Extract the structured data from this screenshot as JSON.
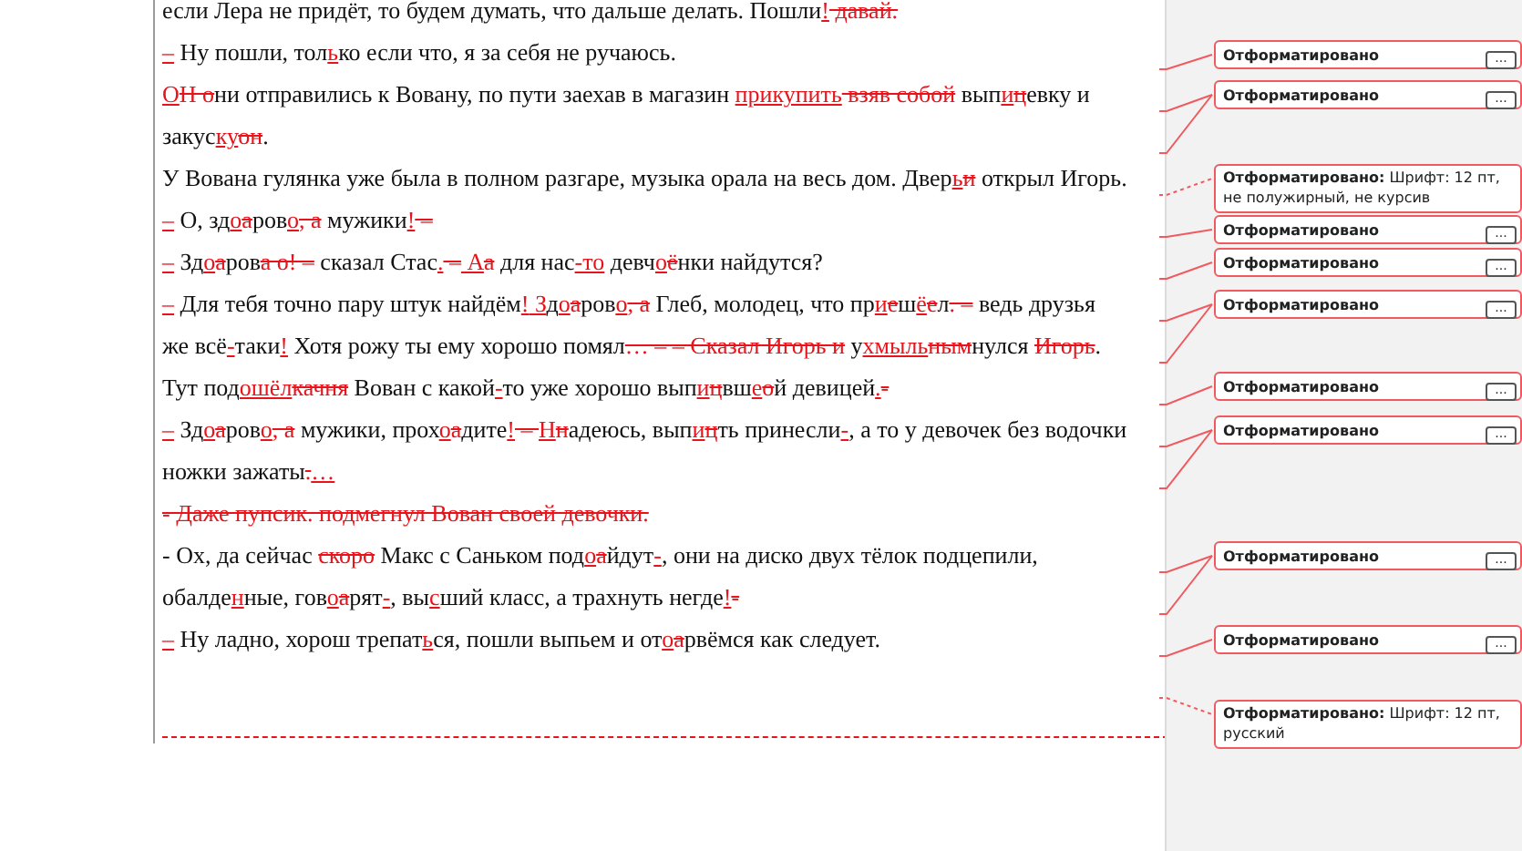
{
  "document": {
    "lines": [
      [
        {
          "kind": "plain",
          "text": "если Лера не придёт, то будем думать, что дальше делать. Пошли"
        },
        {
          "kind": "ins",
          "text": "!"
        },
        {
          "kind": "del",
          "text": " давай."
        }
      ],
      [
        {
          "kind": "ins",
          "text": "–"
        },
        {
          "kind": "plain",
          "text": " Ну пошли, тол"
        },
        {
          "kind": "ins",
          "text": "ь"
        },
        {
          "kind": "plain",
          "text": "ко если что, я за себя не ручаюсь."
        }
      ],
      [
        {
          "kind": "ins",
          "text": "О"
        },
        {
          "kind": "del",
          "text": "Н о"
        },
        {
          "kind": "plain",
          "text": "ни отправились к Вовану, по пути заехав в магазин "
        },
        {
          "kind": "ins",
          "text": "прикупить"
        },
        {
          "kind": "del",
          "text": " взяв собой"
        },
        {
          "kind": "plain",
          "text": " вып"
        },
        {
          "kind": "ins",
          "text": "и"
        },
        {
          "kind": "del",
          "text": "ц"
        },
        {
          "kind": "plain",
          "text": "евку и"
        }
      ],
      [
        {
          "kind": "plain",
          "text": "закус"
        },
        {
          "kind": "ins",
          "text": "ку"
        },
        {
          "kind": "del",
          "text": "он"
        },
        {
          "kind": "plain",
          "text": "."
        }
      ],
      [
        {
          "kind": "plain",
          "text": "У Вована гулянка уже была в полном разгаре, музыка орала на весь дом. Двер"
        },
        {
          "kind": "ins",
          "text": "ь"
        },
        {
          "kind": "del",
          "text": "и"
        },
        {
          "kind": "plain",
          "text": " открыл Игорь."
        }
      ],
      [
        {
          "kind": "ins",
          "text": "–"
        },
        {
          "kind": "plain",
          "text": " О, зд"
        },
        {
          "kind": "ins",
          "text": "о"
        },
        {
          "kind": "del",
          "text": "а"
        },
        {
          "kind": "plain",
          "text": "ров"
        },
        {
          "kind": "ins",
          "text": "о"
        },
        {
          "kind": "del",
          "text": ", а"
        },
        {
          "kind": "plain",
          "text": " мужики"
        },
        {
          "kind": "ins",
          "text": "!"
        },
        {
          "kind": "del",
          "text": " –"
        }
      ],
      [
        {
          "kind": "ins",
          "text": "–"
        },
        {
          "kind": "plain",
          "text": " Зд"
        },
        {
          "kind": "ins",
          "text": "о"
        },
        {
          "kind": "del",
          "text": "а"
        },
        {
          "kind": "plain",
          "text": "ров"
        },
        {
          "kind": "del",
          "text": "а о! –"
        },
        {
          "kind": "plain",
          "text": " сказал Стас"
        },
        {
          "kind": "ins",
          "text": "."
        },
        {
          "kind": "del",
          "text": " –"
        },
        {
          "kind": "ins",
          "text": " А"
        },
        {
          "kind": "del",
          "text": "а"
        },
        {
          "kind": "plain",
          "text": " для нас"
        },
        {
          "kind": "ins",
          "text": "-то"
        },
        {
          "kind": "plain",
          "text": " девч"
        },
        {
          "kind": "ins",
          "text": "о"
        },
        {
          "kind": "del",
          "text": "ё"
        },
        {
          "kind": "plain",
          "text": "нки найдутся?"
        }
      ],
      [
        {
          "kind": "ins",
          "text": "–"
        },
        {
          "kind": "plain",
          "text": " Для тебя точно пару штук найдём"
        },
        {
          "kind": "ins",
          "text": "!"
        },
        {
          "kind": "ins",
          "text": " З"
        },
        {
          "kind": "plain",
          "text": "д"
        },
        {
          "kind": "ins",
          "text": "о"
        },
        {
          "kind": "del",
          "text": "а"
        },
        {
          "kind": "plain",
          "text": "ров"
        },
        {
          "kind": "ins",
          "text": "о"
        },
        {
          "kind": "del",
          "text": ", а"
        },
        {
          "kind": "plain",
          "text": " Глеб, молодец, что пр"
        },
        {
          "kind": "ins",
          "text": "и"
        },
        {
          "kind": "del",
          "text": "е"
        },
        {
          "kind": "plain",
          "text": "ш"
        },
        {
          "kind": "ins",
          "text": "ё"
        },
        {
          "kind": "del",
          "text": "е"
        },
        {
          "kind": "plain",
          "text": "л"
        },
        {
          "kind": "del",
          "text": ". –"
        },
        {
          "kind": "plain",
          "text": " ведь друзья"
        }
      ],
      [
        {
          "kind": "plain",
          "text": "же всё"
        },
        {
          "kind": "ins",
          "text": "-"
        },
        {
          "kind": "plain",
          "text": "таки"
        },
        {
          "kind": "ins",
          "text": "!"
        },
        {
          "kind": "plain",
          "text": " Хотя рожу ты ему хорошо помял"
        },
        {
          "kind": "del",
          "text": "… – – Сказал Игорь и"
        },
        {
          "kind": "plain",
          "text": " у"
        },
        {
          "kind": "ins",
          "text": "хмыль"
        },
        {
          "kind": "del",
          "text": "ным"
        },
        {
          "kind": "plain",
          "text": "нулся "
        },
        {
          "kind": "del",
          "text": "Игорь"
        },
        {
          "kind": "plain",
          "text": "."
        }
      ],
      [
        {
          "kind": "plain",
          "text": "Тут под"
        },
        {
          "kind": "ins",
          "text": "ошёл"
        },
        {
          "kind": "del",
          "text": "качня"
        },
        {
          "kind": "plain",
          "text": " Вован с какой"
        },
        {
          "kind": "ins",
          "text": "-"
        },
        {
          "kind": "plain",
          "text": "то уже хорошо вып"
        },
        {
          "kind": "ins",
          "text": "и"
        },
        {
          "kind": "del",
          "text": "ц"
        },
        {
          "kind": "plain",
          "text": "вш"
        },
        {
          "kind": "ins",
          "text": "е"
        },
        {
          "kind": "del",
          "text": "о"
        },
        {
          "kind": "plain",
          "text": "й девицей"
        },
        {
          "kind": "ins",
          "text": "."
        },
        {
          "kind": "del",
          "text": "-"
        }
      ],
      [
        {
          "kind": "ins",
          "text": "–"
        },
        {
          "kind": "plain",
          "text": " Зд"
        },
        {
          "kind": "ins",
          "text": "о"
        },
        {
          "kind": "del",
          "text": "а"
        },
        {
          "kind": "plain",
          "text": "ров"
        },
        {
          "kind": "ins",
          "text": "о"
        },
        {
          "kind": "del",
          "text": ", а"
        },
        {
          "kind": "plain",
          "text": " мужики, прох"
        },
        {
          "kind": "ins",
          "text": "о"
        },
        {
          "kind": "del",
          "text": "а"
        },
        {
          "kind": "plain",
          "text": "дите"
        },
        {
          "kind": "ins",
          "text": "!"
        },
        {
          "kind": "del",
          "text": " – "
        },
        {
          "kind": "ins",
          "text": "Н"
        },
        {
          "kind": "del",
          "text": "н"
        },
        {
          "kind": "plain",
          "text": "адеюсь, вып"
        },
        {
          "kind": "ins",
          "text": "и"
        },
        {
          "kind": "del",
          "text": "ц"
        },
        {
          "kind": "plain",
          "text": "ть принесли"
        },
        {
          "kind": "ins",
          "text": "-"
        },
        {
          "kind": "plain",
          "text": ", а то у девочек без водочки"
        }
      ],
      [
        {
          "kind": "plain",
          "text": "ножки зажаты"
        },
        {
          "kind": "del",
          "text": "."
        },
        {
          "kind": "ins",
          "text": "…"
        }
      ],
      [
        {
          "kind": "del",
          "text": "- Даже пупсик. подмегнул Вован своей девочки."
        }
      ],
      [
        {
          "kind": "plain",
          "text": "- Ох, да сейчас "
        },
        {
          "kind": "del",
          "text": "скоро"
        },
        {
          "kind": "plain",
          "text": " Макс с Саньком под"
        },
        {
          "kind": "ins",
          "text": "о"
        },
        {
          "kind": "del",
          "text": "а"
        },
        {
          "kind": "plain",
          "text": "йдут"
        },
        {
          "kind": "ins",
          "text": "-"
        },
        {
          "kind": "plain",
          "text": ", они на диско двух тёлок подцепили,"
        }
      ],
      [
        {
          "kind": "plain",
          "text": "обалде"
        },
        {
          "kind": "ins",
          "text": "н"
        },
        {
          "kind": "plain",
          "text": "ные, гов"
        },
        {
          "kind": "ins",
          "text": "о"
        },
        {
          "kind": "del",
          "text": "а"
        },
        {
          "kind": "plain",
          "text": "рят"
        },
        {
          "kind": "ins",
          "text": "-"
        },
        {
          "kind": "plain",
          "text": ", вы"
        },
        {
          "kind": "ins",
          "text": "с"
        },
        {
          "kind": "plain",
          "text": "ший класс, а трахнуть негде"
        },
        {
          "kind": "ins",
          "text": "!"
        },
        {
          "kind": "del",
          "text": "-"
        }
      ],
      [
        {
          "kind": "ins",
          "text": "–"
        },
        {
          "kind": "plain",
          "text": " Ну ладно, хорош трепат"
        },
        {
          "kind": "ins",
          "text": "ь"
        },
        {
          "kind": "plain",
          "text": "ся, пошли выпьем и от"
        },
        {
          "kind": "ins",
          "text": "о"
        },
        {
          "kind": "del",
          "text": "а"
        },
        {
          "kind": "plain",
          "text": "рвёмся как следует."
        }
      ]
    ]
  },
  "balloons": [
    {
      "label": "Отформатировано",
      "more_button": "..."
    },
    {
      "label": "Отформатировано",
      "more_button": "..."
    },
    {
      "label": "Отформатировано:",
      "detail": "Шрифт: 12 пт, не полужирный, не курсив"
    },
    {
      "label": "Отформатировано",
      "more_button": "..."
    },
    {
      "label": "Отформатировано",
      "more_button": "..."
    },
    {
      "label": "Отформатировано",
      "more_button": "..."
    },
    {
      "label": "Отформатировано",
      "more_button": "..."
    },
    {
      "label": "Отформатировано",
      "more_button": "..."
    },
    {
      "label": "Отформатировано",
      "more_button": "..."
    },
    {
      "label": "Отформатировано",
      "more_button": "..."
    },
    {
      "label": "Отформатировано:",
      "detail": "Шрифт: 12 пт, русский"
    }
  ]
}
